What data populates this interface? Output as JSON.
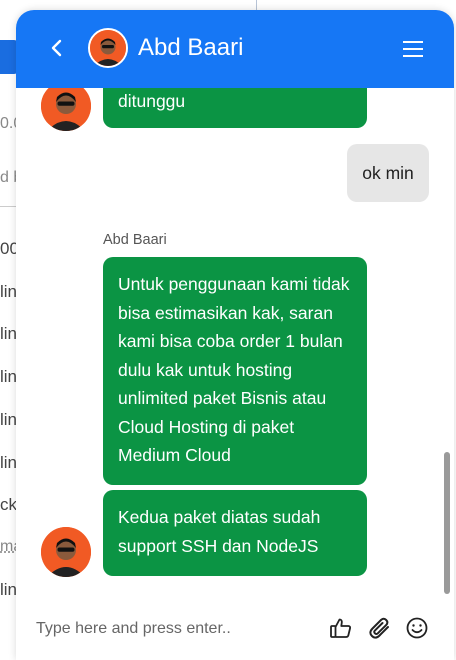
{
  "background_page": {
    "fragments": [
      "0.0",
      "d b",
      "00",
      "lin",
      "lin",
      "lin",
      "lin",
      "lin",
      "ck",
      "ma",
      "lin"
    ]
  },
  "chat": {
    "header": {
      "agent_name": "Abd Baari",
      "back_icon": "chevron-left-icon",
      "menu_icon": "hamburger-menu-icon",
      "color": "#1677f5"
    },
    "messages": [
      {
        "from": "agent",
        "text": "ditunggu"
      },
      {
        "from": "user",
        "text": "ok min"
      },
      {
        "from": "agent",
        "sender": "Abd Baari",
        "text": "Untuk penggunaan kami tidak bisa estimasikan kak, saran kami bisa coba order 1 bulan dulu kak untuk hosting unlimited paket Bisnis atau Cloud Hosting di paket Medium Cloud"
      },
      {
        "from": "agent",
        "text": "Kedua paket diatas sudah support SSH dan NodeJS"
      }
    ],
    "agent_bubble_color": "#0b9444",
    "user_bubble_color": "#e6e6e6",
    "composer": {
      "placeholder": "Type here and press enter..",
      "icons": [
        "thumbs-up-icon",
        "paperclip-icon",
        "smiley-icon"
      ]
    }
  }
}
